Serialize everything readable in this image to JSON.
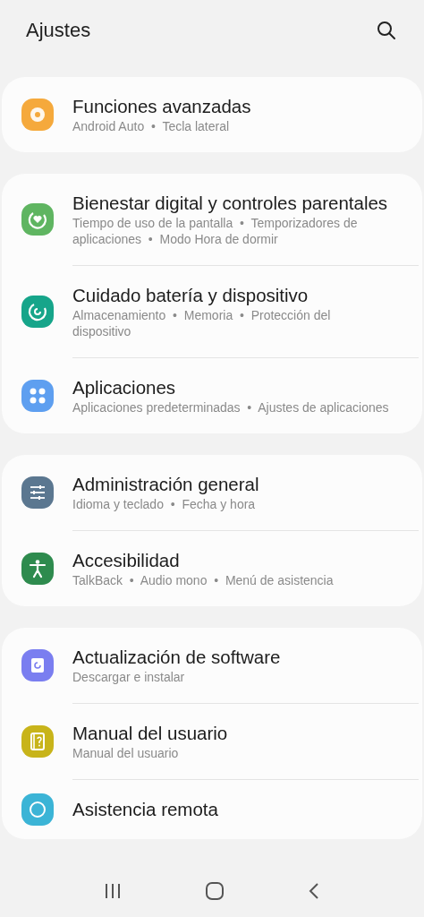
{
  "header": {
    "title": "Ajustes"
  },
  "groups": [
    {
      "items": [
        {
          "kind": "gear",
          "color": "#f5a93c",
          "title": "Funciones avanzadas",
          "subtitle": "Android Auto  •  Tecla lateral"
        }
      ]
    },
    {
      "items": [
        {
          "kind": "heart-ring",
          "color": "#5fb561",
          "title": "Bienestar digital y controles parentales",
          "subtitle": "Tiempo de uso de la pantalla  •  Temporizadores de aplicaciones  •  Modo Hora de dormir"
        },
        {
          "kind": "refresh-ring",
          "color": "#16a58a",
          "title": "Cuidado batería y dispositivo",
          "subtitle": "Almacenamiento  •  Memoria  •  Protección del dispositivo"
        },
        {
          "kind": "grid",
          "color": "#5e9ff0",
          "title": "Aplicaciones",
          "subtitle": "Aplicaciones predeterminadas  •  Ajustes de aplicaciones"
        }
      ]
    },
    {
      "items": [
        {
          "kind": "sliders",
          "color": "#5b7790",
          "title": "Administración general",
          "subtitle": "Idioma y teclado  •  Fecha y hora"
        },
        {
          "kind": "person",
          "color": "#2e8b4e",
          "title": "Accesibilidad",
          "subtitle": "TalkBack  •  Audio mono  •  Menú de asistencia"
        }
      ]
    },
    {
      "items": [
        {
          "kind": "update",
          "color": "#7a7ef0",
          "title": "Actualización de software",
          "subtitle": "Descargar e instalar"
        },
        {
          "kind": "book",
          "color": "#c8b41a",
          "title": "Manual del usuario",
          "subtitle": "Manual del usuario"
        },
        {
          "kind": "support",
          "color": "#3bb4d6",
          "title": "Asistencia remota"
        }
      ]
    }
  ]
}
